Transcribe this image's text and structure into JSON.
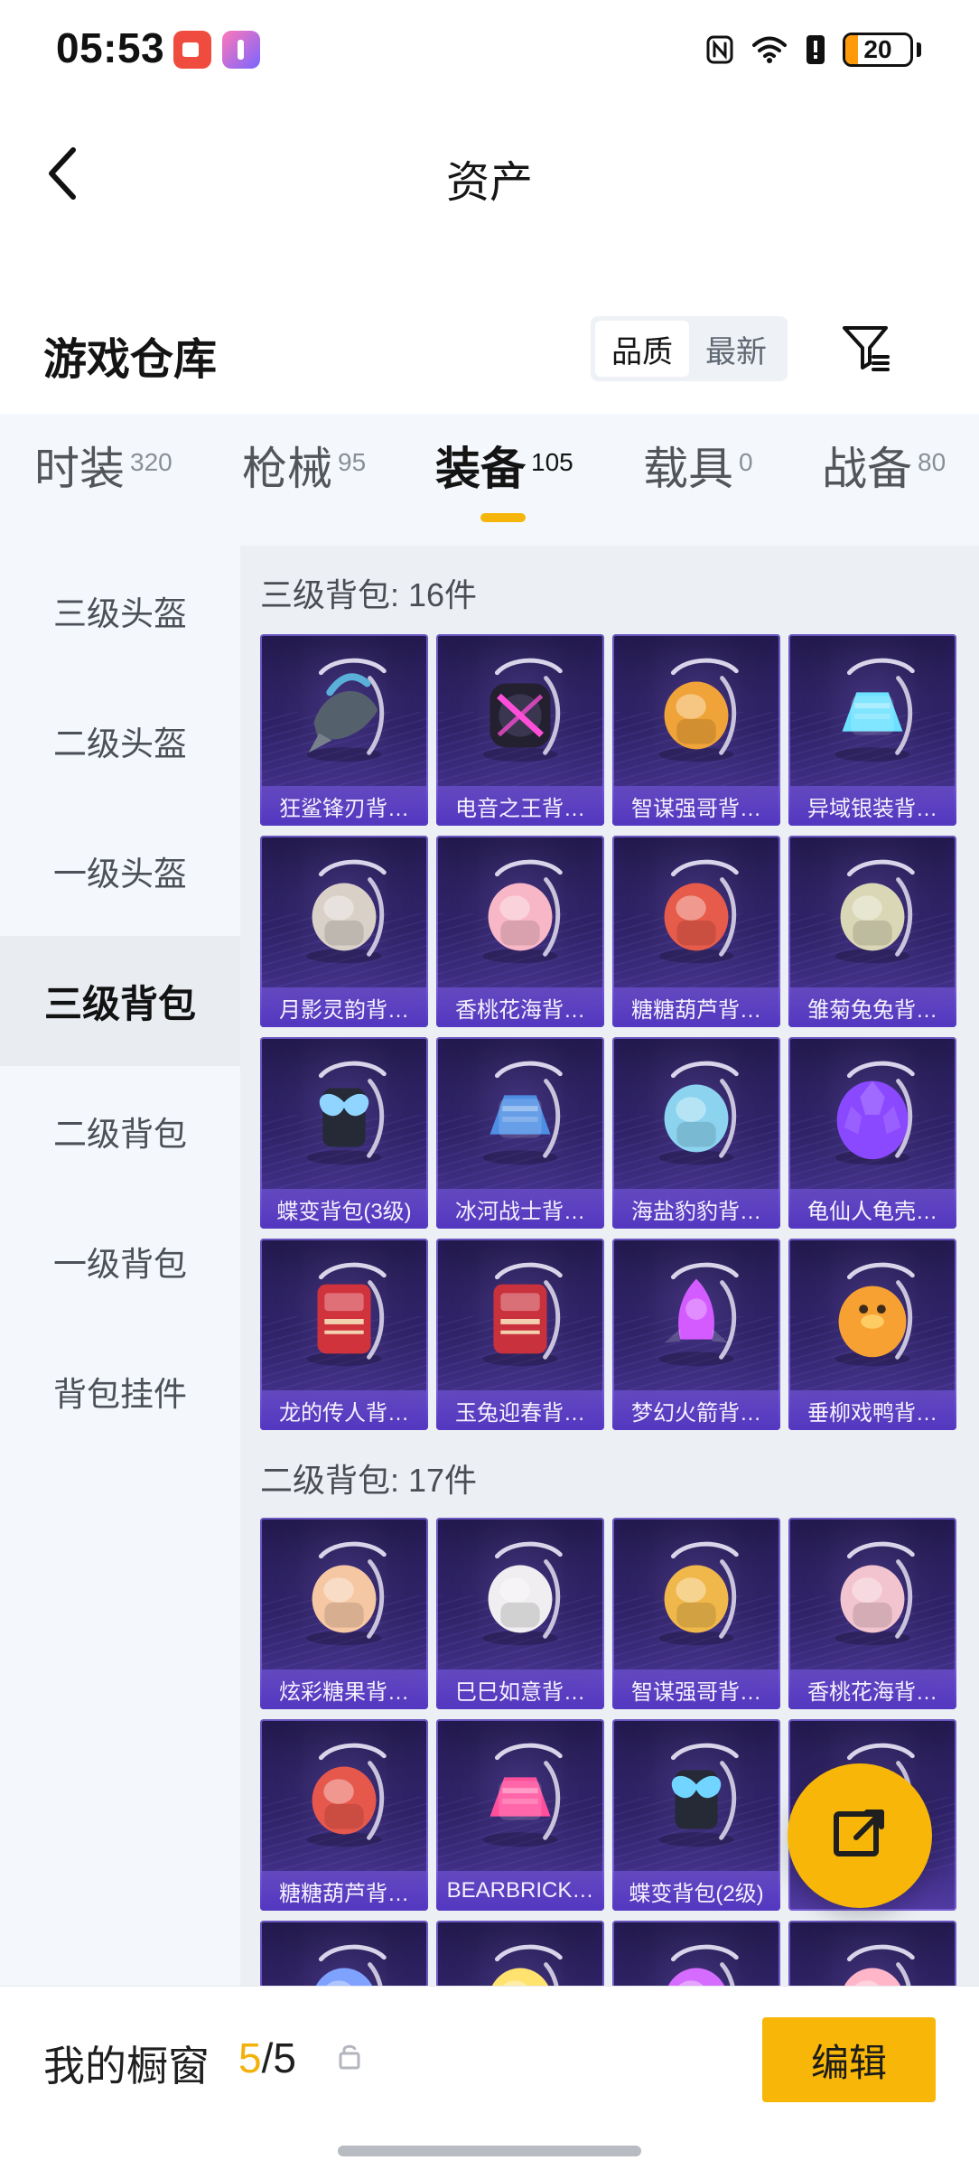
{
  "status_bar": {
    "time": "05:53",
    "battery": "20",
    "battery_level": 0.2,
    "icons": [
      "notification-app-icon",
      "notification-app-icon",
      "nfc-icon",
      "wifi-icon",
      "alert-icon",
      "battery-icon"
    ]
  },
  "header": {
    "title": "资产",
    "back_icon": "back-icon"
  },
  "warehouse": {
    "title": "游戏仓库",
    "sort_options": [
      "品质",
      "最新"
    ],
    "active_sort": 0,
    "filter_icon": "filter-icon"
  },
  "category_tabs": [
    {
      "label": "时装",
      "count": "320",
      "active": false
    },
    {
      "label": "枪械",
      "count": "95",
      "active": false
    },
    {
      "label": "装备",
      "count": "105",
      "active": true
    },
    {
      "label": "载具",
      "count": "0",
      "active": false
    },
    {
      "label": "战备",
      "count": "80",
      "active": false
    }
  ],
  "side_menu": [
    {
      "label": "三级头盔",
      "active": false
    },
    {
      "label": "二级头盔",
      "active": false
    },
    {
      "label": "一级头盔",
      "active": false
    },
    {
      "label": "三级背包",
      "active": true
    },
    {
      "label": "二级背包",
      "active": false
    },
    {
      "label": "一级背包",
      "active": false
    },
    {
      "label": "背包挂件",
      "active": false
    }
  ],
  "sections": [
    {
      "title": "三级背包: 16件",
      "items": [
        {
          "label": "狂鲨锋刃背…",
          "icon": "shark-backpack",
          "accent": "#5ab0d8"
        },
        {
          "label": "电音之王背…",
          "icon": "speaker-backpack",
          "accent": "#ff4fd8"
        },
        {
          "label": "智谋强哥背…",
          "icon": "bear-backpack",
          "accent": "#f0a338"
        },
        {
          "label": "异域银装背…",
          "icon": "tactical-backpack",
          "accent": "#6ce1ff"
        },
        {
          "label": "月影灵韵背…",
          "icon": "moon-backpack",
          "accent": "#d9d1c8"
        },
        {
          "label": "香桃花海背…",
          "icon": "peach-backpack",
          "accent": "#f7b7c7"
        },
        {
          "label": "糖糖葫芦背…",
          "icon": "gourd-backpack",
          "accent": "#e75b4a"
        },
        {
          "label": "雏菊兔兔背…",
          "icon": "rabbit-backpack",
          "accent": "#d9d7b5"
        },
        {
          "label": "蝶变背包(3级)",
          "icon": "butterfly-backpack",
          "accent": "#8fd5ff"
        },
        {
          "label": "冰河战士背…",
          "icon": "armor-backpack",
          "accent": "#4f8ee5"
        },
        {
          "label": "海盐豹豹背…",
          "icon": "seal-backpack",
          "accent": "#8bd3ef"
        },
        {
          "label": "龟仙人龟壳…",
          "icon": "turtle-backpack",
          "accent": "#8b49ff"
        },
        {
          "label": "龙的传人背…",
          "icon": "dragon-backpack",
          "accent": "#d1333d"
        },
        {
          "label": "玉兔迎春背…",
          "icon": "spring-backpack",
          "accent": "#c9313d"
        },
        {
          "label": "梦幻火箭背…",
          "icon": "rocket-backpack",
          "accent": "#d45bff"
        },
        {
          "label": "垂柳戏鸭背…",
          "icon": "duck-backpack",
          "accent": "#f7a133"
        }
      ]
    },
    {
      "title": "二级背包: 17件",
      "items": [
        {
          "label": "炫彩糖果背…",
          "icon": "candy-backpack",
          "accent": "#f5c7a3"
        },
        {
          "label": "巳巳如意背…",
          "icon": "snake-backpack",
          "accent": "#f0eef0"
        },
        {
          "label": "智谋强哥背…",
          "icon": "bear-backpack",
          "accent": "#f0b84b"
        },
        {
          "label": "香桃花海背…",
          "icon": "peach-backpack",
          "accent": "#f2c4cf"
        },
        {
          "label": "糖糖葫芦背…",
          "icon": "gourd-backpack",
          "accent": "#e7584c"
        },
        {
          "label": "BEARBRICK…",
          "icon": "bearbrick-backpack",
          "accent": "#ff4f9c"
        },
        {
          "label": "蝶变背包(2级)",
          "icon": "butterfly-backpack",
          "accent": "#71d5ff"
        },
        {
          "label": "",
          "icon": "hidden-backpack",
          "accent": "#d8dfe8"
        },
        {
          "label": "",
          "icon": "backpack-icon",
          "accent": "#7fa2ff"
        },
        {
          "label": "",
          "icon": "backpack-icon",
          "accent": "#ffe36e"
        },
        {
          "label": "",
          "icon": "backpack-icon",
          "accent": "#d66cff"
        },
        {
          "label": "",
          "icon": "backpack-icon",
          "accent": "#ffb6c8"
        }
      ]
    }
  ],
  "share_button": {
    "icon": "share-icon"
  },
  "showcase": {
    "label": "我的橱窗",
    "current": "5",
    "separator": "/",
    "total": "5",
    "lock_icon": "lock-icon",
    "edit_label": "编辑"
  }
}
